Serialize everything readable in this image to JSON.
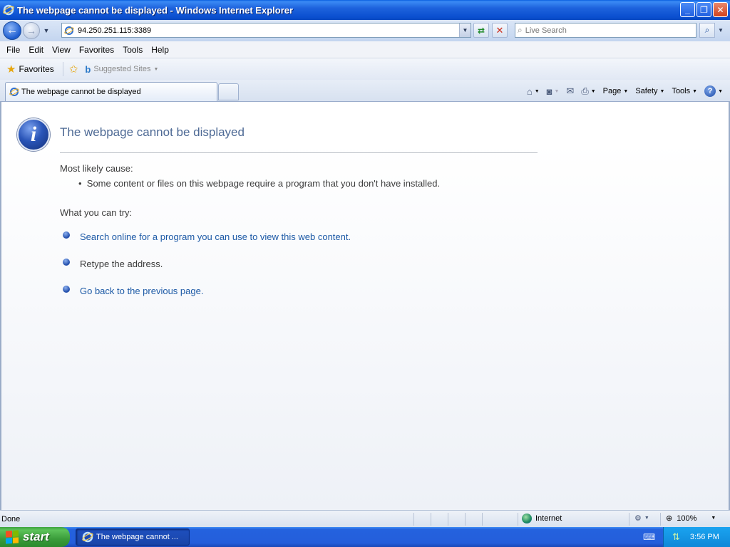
{
  "window": {
    "title": "The webpage cannot be displayed - Windows Internet Explorer",
    "minimize": "_",
    "restore": "❐",
    "close": "✕"
  },
  "nav": {
    "address": "94.250.251.115:3389",
    "search_placeholder": "Live Search"
  },
  "menu": [
    "File",
    "Edit",
    "View",
    "Favorites",
    "Tools",
    "Help"
  ],
  "favorites_bar": {
    "favorites_label": "Favorites",
    "suggested_sites_label": "Suggested Sites"
  },
  "tab": {
    "title": "The webpage cannot be displayed"
  },
  "command_bar": {
    "page_label": "Page",
    "safety_label": "Safety",
    "tools_label": "Tools"
  },
  "error_page": {
    "title": "The webpage cannot be displayed",
    "cause_label": "Most likely cause:",
    "cause_item": "Some content or files on this webpage require a program that you don't have installed.",
    "try_label": "What you can try:",
    "try_items": [
      {
        "text": "Search online for a program you can use to view this web content.",
        "link": true
      },
      {
        "text": "Retype the address.",
        "link": false
      },
      {
        "text": "Go back to the previous page.",
        "link": true
      }
    ]
  },
  "status_bar": {
    "status": "Done",
    "zone": "Internet",
    "zoom": "100%"
  },
  "taskbar": {
    "start_label": "start",
    "task_item": "The webpage cannot ...",
    "clock": "3:56 PM"
  },
  "colors": {
    "link": "#1d5aa6",
    "title_text": "#4e6a95",
    "titlebar": "#0a4fd0",
    "start_green": "#3a9c3a"
  }
}
